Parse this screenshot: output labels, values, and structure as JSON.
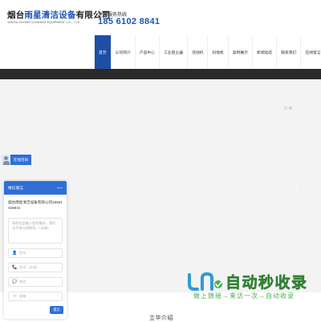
{
  "header": {
    "company_name_pre": "烟台",
    "company_name_accent": "雨星清洁设备",
    "company_name_post": "有限公司",
    "company_name_en": "YANTAI YUXING CLEANING EQUIPMENT CO.，LTD",
    "hotline_label": "全国服务热线",
    "hotline_number": "185 6102 8841"
  },
  "nav": {
    "items": [
      {
        "label": "首页",
        "active": true
      },
      {
        "label": "公司简介",
        "active": false
      },
      {
        "label": "产品中心",
        "active": false
      },
      {
        "label": "工业吸尘器",
        "active": false
      },
      {
        "label": "洗地机",
        "active": false
      },
      {
        "label": "扫地机",
        "active": false
      },
      {
        "label": "案例展示",
        "active": false
      },
      {
        "label": "新闻动态",
        "active": false
      },
      {
        "label": "联系我们",
        "active": false
      },
      {
        "label": "在线留言",
        "active": false
      }
    ]
  },
  "consult": {
    "label": "在线咨询"
  },
  "panel": {
    "title": "微信留言",
    "minimize": "—",
    "company_phone": "烟台雨星清洁设备有限公司18561028841",
    "textarea_placeholder": "请您在此输入您的需求，我们会尽快与您联系。（必填）",
    "fields": [
      {
        "icon": "user-icon",
        "glyph": "👤",
        "placeholder": "姓名"
      },
      {
        "icon": "phone-icon",
        "glyph": "📞",
        "placeholder": "电话（必填）"
      },
      {
        "icon": "wechat-icon",
        "glyph": "💬",
        "placeholder": "微信"
      },
      {
        "icon": "email-icon",
        "glyph": "✉",
        "placeholder": "邮箱"
      }
    ],
    "submit_label": "提交"
  },
  "watermark": {
    "brand_text": "自动秒收录",
    "slogan": "做上铸接→来访一次→自动收录"
  },
  "section": {
    "title": "立华介绍"
  },
  "colors": {
    "brand_blue": "#1e4fa6",
    "accent_blue": "#2f6fd6",
    "watermark_green": "#4caf50"
  }
}
